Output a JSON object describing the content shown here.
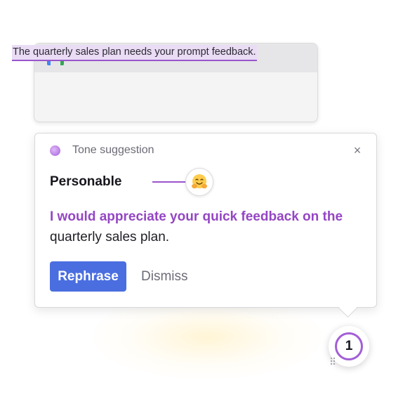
{
  "email": {
    "app_icon": "gmail-icon",
    "highlighted_text": "The quarterly sales plan needs your prompt feedback."
  },
  "popup": {
    "header_label": "Tone suggestion",
    "close_icon": "close-icon",
    "tone_name": "Personable",
    "tone_emoji": "hugging-face-emoji",
    "suggestion_highlight": "I would appreciate your quick feedback on the",
    "suggestion_rest": "quarterly sales plan.",
    "rephrase_label": "Rephrase",
    "dismiss_label": "Dismiss"
  },
  "badge": {
    "count": "1",
    "grip_icon": "drag-handle-icon"
  },
  "colors": {
    "accent_purple": "#9446c4",
    "highlight_bg": "#eadcf5",
    "button_blue": "#4a6ee0"
  }
}
